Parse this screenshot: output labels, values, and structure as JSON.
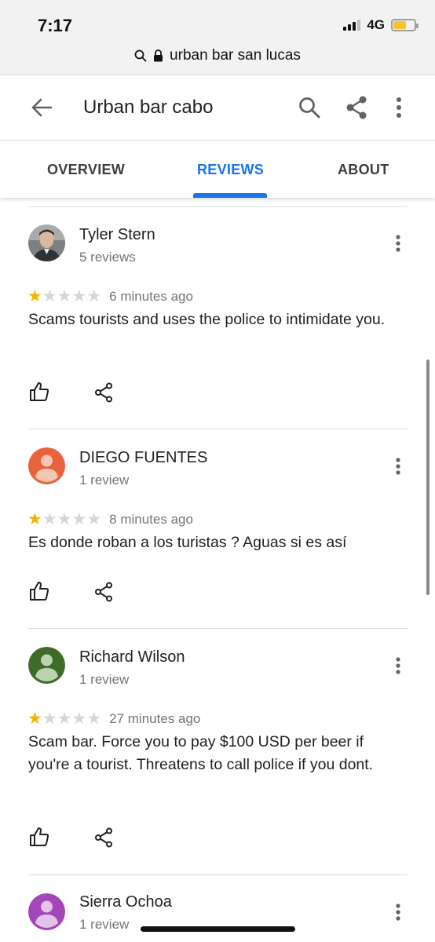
{
  "status_bar": {
    "time": "7:17",
    "network": "4G"
  },
  "browser": {
    "url_text": "urban bar san lucas"
  },
  "app_bar": {
    "title": "Urban bar cabo"
  },
  "tabs": [
    {
      "label": "OVERVIEW",
      "active": false
    },
    {
      "label": "REVIEWS",
      "active": true
    },
    {
      "label": "ABOUT",
      "active": false
    }
  ],
  "reviews": [
    {
      "name": "Tyler Stern",
      "meta": "5 reviews",
      "rating": 1,
      "max_rating": 5,
      "time_ago": "6 minutes ago",
      "text": "Scams tourists and uses the police to intimidate you.",
      "avatar": "photo"
    },
    {
      "name": "DIEGO FUENTES",
      "meta": "1 review",
      "rating": 1,
      "max_rating": 5,
      "time_ago": "8 minutes ago",
      "text": "Es donde roban a los turistas ? Aguas si es así",
      "avatar_color": "#e8623c"
    },
    {
      "name": "Richard Wilson",
      "meta": "1 review",
      "rating": 1,
      "max_rating": 5,
      "time_ago": "27 minutes ago",
      "text": "Scam bar. Force you to pay $100 USD per beer if you're a tourist. Threatens to call police if you dont.",
      "avatar_color": "#3f6b2a"
    },
    {
      "name": "Sierra Ochoa",
      "meta": "1 review",
      "avatar_color": "#a346b8"
    }
  ],
  "colors": {
    "accent": "#1a73e8",
    "star": "#f4b400",
    "battery": "#f4c22b"
  }
}
